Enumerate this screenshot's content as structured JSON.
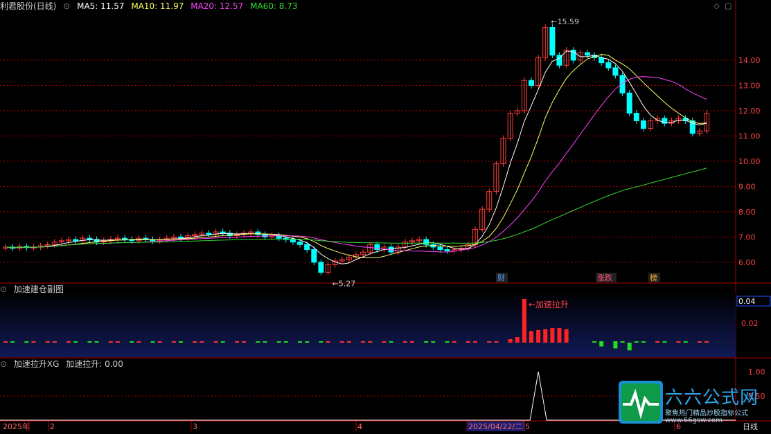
{
  "main_header": {
    "stock_label": "利君股份(日线)",
    "ma5": "MA5: 11.57",
    "ma10": "MA10: 11.97",
    "ma20": "MA20: 12.57",
    "ma60": "MA60: 8.73"
  },
  "sub1_header": {
    "title": "加速建仓副图",
    "value_box": "0.04"
  },
  "sub2_header": {
    "title": "加速拉升XG",
    "value": "加速拉升: 0.00"
  },
  "annotations": {
    "high": "15.59",
    "low": "5.27",
    "signal": "加速拉升"
  },
  "event_markers": [
    {
      "label": "财",
      "color": "#4aa3ff"
    },
    {
      "label": "涨跌",
      "color": "#ff5577"
    },
    {
      "label": "榜",
      "color": "#ffaa33"
    }
  ],
  "bottom_axis": {
    "labels": [
      "2025年",
      "2",
      "3",
      "4",
      "2025/04/22/二",
      "5",
      "6"
    ],
    "period": "日线"
  },
  "colors": {
    "up": "#ff3b3b",
    "down": "#00ffff",
    "ma5": "#ffffff",
    "ma10": "#ffff66",
    "ma20": "#ff44ff",
    "ma60": "#33dd33",
    "grid": "#aa0000"
  },
  "watermark": {
    "brand": "六六公式网",
    "sub": "聚焦热门精品炒股指标公式",
    "url": "www.66gsw.com"
  },
  "chart_data": [
    {
      "type": "candlestick",
      "title": "利君股份(日线)",
      "ylim": [
        5.2,
        16.0
      ],
      "yticks": [
        "14.00",
        "13.00",
        "12.00",
        "11.00",
        "10.00",
        "9.00",
        "8.00",
        "7.00",
        "6.00"
      ],
      "closes": [
        6.6,
        6.55,
        6.62,
        6.58,
        6.6,
        6.65,
        6.7,
        6.8,
        6.85,
        6.9,
        6.85,
        6.95,
        6.9,
        6.8,
        6.85,
        6.9,
        6.95,
        6.9,
        6.85,
        6.95,
        6.9,
        6.85,
        6.9,
        6.95,
        7.0,
        6.95,
        7.05,
        7.1,
        7.15,
        7.1,
        7.2,
        7.15,
        7.05,
        7.1,
        7.15,
        7.2,
        7.1,
        7.0,
        7.05,
        6.95,
        6.9,
        6.8,
        6.7,
        6.5,
        6.0,
        5.6,
        5.9,
        6.05,
        6.1,
        6.2,
        6.3,
        6.4,
        6.7,
        6.5,
        6.6,
        6.4,
        6.6,
        6.8,
        6.85,
        6.9,
        6.7,
        6.6,
        6.5,
        6.45,
        6.5,
        6.55,
        6.7,
        7.3,
        8.1,
        8.8,
        9.9,
        10.9,
        11.9,
        12.0,
        13.2,
        13.0,
        14.1,
        15.3,
        14.2,
        13.8,
        14.4,
        14.0,
        14.3,
        14.2,
        14.1,
        13.9,
        13.7,
        13.4,
        12.7,
        11.9,
        11.6,
        11.3,
        11.6,
        11.7,
        11.5,
        11.6,
        11.7,
        11.6,
        11.1,
        11.2,
        11.9
      ],
      "ma_values": {
        "MA5": 11.57,
        "MA10": 11.97,
        "MA20": 12.57,
        "MA60": 8.73
      },
      "high_mark": 15.59,
      "low_mark": 5.27
    },
    {
      "type": "bar",
      "title": "加速建仓副图",
      "ylim": [
        0,
        0.05
      ],
      "yticks": [
        "0.04",
        "0.02"
      ],
      "red_big": [
        {
          "index": 75,
          "value": 0.045
        }
      ],
      "red_mid": [
        0.012,
        0.013,
        0.014,
        0.015,
        0.015,
        0.014
      ],
      "green_neg": [
        0.004,
        0.006,
        0.008
      ]
    },
    {
      "type": "line",
      "title": "加速拉升XG",
      "ylim": [
        0,
        1.1
      ],
      "yticks": [
        "1.00",
        "0.50"
      ],
      "spike_index": 76
    }
  ]
}
